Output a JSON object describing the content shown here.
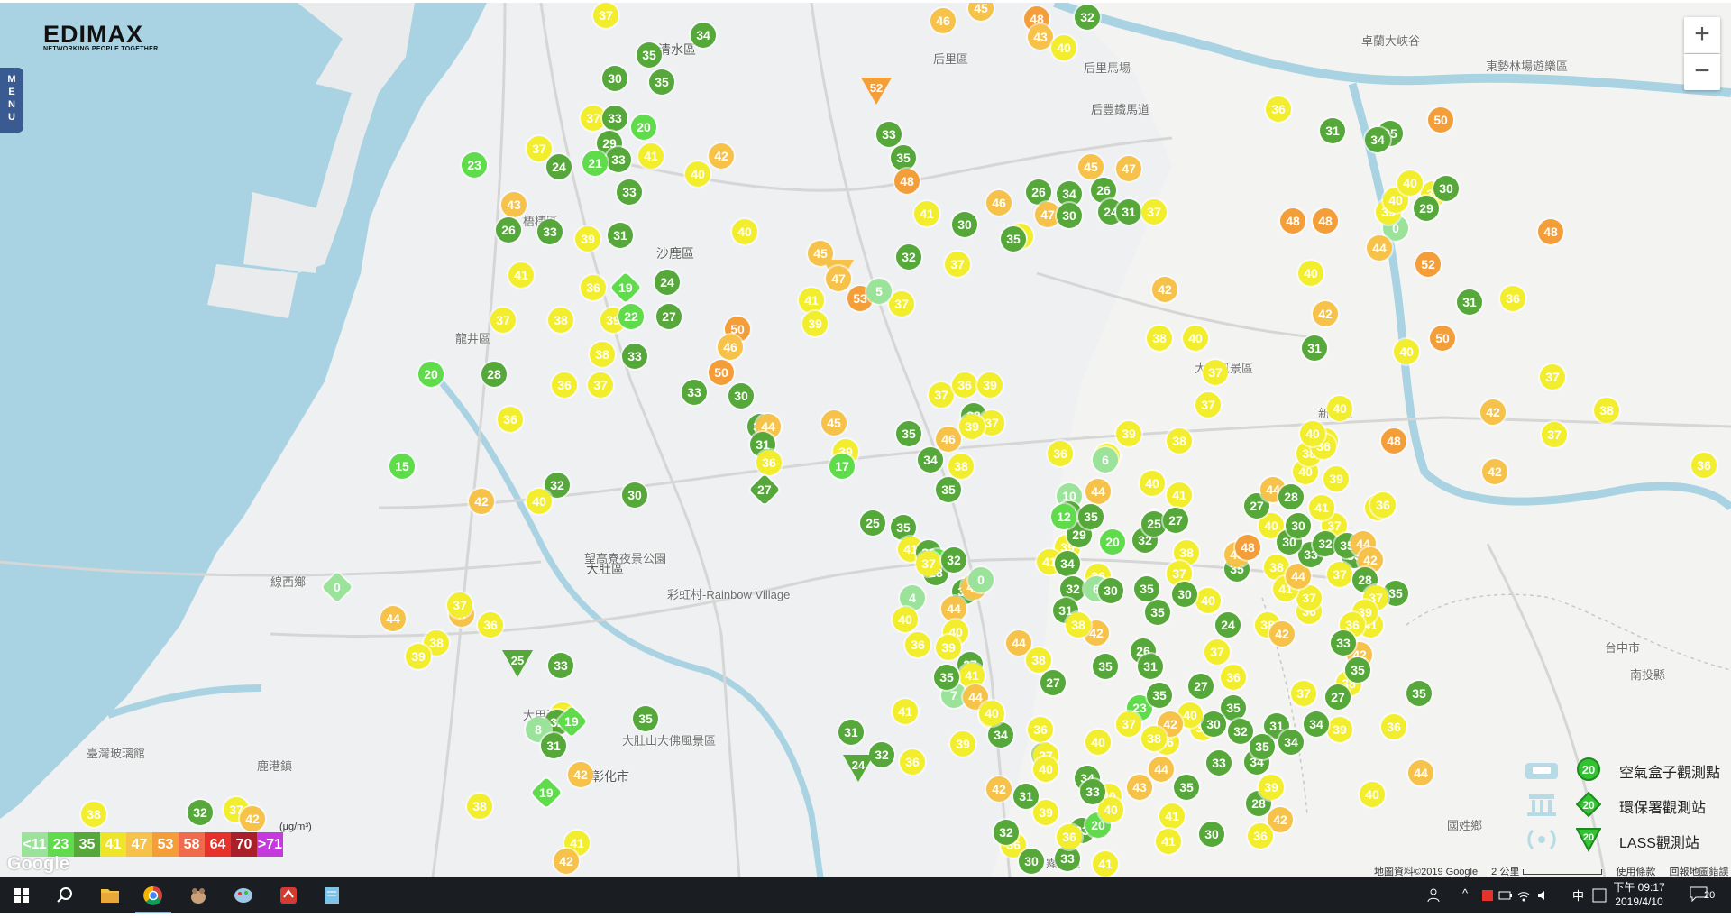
{
  "logo": {
    "word": "EDIMAX",
    "tagline": "NETWORKING PEOPLE TOGETHER"
  },
  "menu_tab": {
    "label": "MENU"
  },
  "zoom": {
    "in_label": "+",
    "out_label": "−"
  },
  "colors": {
    "lt11": "#9be39b",
    "lt23": "#5fdb4c",
    "lt35": "#56a83a",
    "lt41": "#f3ee2d",
    "lt47": "#f6c24a",
    "lt53": "#f49e3a",
    "lt58": "#f06b4b",
    "lt64": "#e5322b",
    "lt70": "#a9202b",
    "gt71": "#c53adc"
  },
  "aqi_scale": {
    "unit": "(μg/m³)",
    "cells": [
      {
        "label": "<11",
        "color": "#9be39b"
      },
      {
        "label": "23",
        "color": "#5fdb4c"
      },
      {
        "label": "35",
        "color": "#56a83a"
      },
      {
        "label": "41",
        "color": "#eee52a"
      },
      {
        "label": "47",
        "color": "#f6c24a"
      },
      {
        "label": "53",
        "color": "#f49e3a"
      },
      {
        "label": "58",
        "color": "#f06b4b"
      },
      {
        "label": "64",
        "color": "#e5322b"
      },
      {
        "label": "70",
        "color": "#a9202b"
      },
      {
        "label": ">71",
        "color": "#c53adc"
      }
    ]
  },
  "places": [
    {
      "text": "清水區",
      "big": true
    },
    {
      "text": "梧棲區"
    },
    {
      "text": "沙鹿區",
      "big": true
    },
    {
      "text": "龍井區"
    },
    {
      "text": "大肚區",
      "big": true
    },
    {
      "text": "線西鄉"
    },
    {
      "text": "鹿港鎮"
    },
    {
      "text": "彰化市",
      "big": true
    },
    {
      "text": "大坑風景區"
    },
    {
      "text": "新社區"
    },
    {
      "text": "后里區"
    },
    {
      "text": "后里馬場"
    },
    {
      "text": "后豐鐵馬道"
    },
    {
      "text": "東勢林場遊樂區"
    },
    {
      "text": "卓蘭大峽谷"
    },
    {
      "text": "國姓鄉"
    },
    {
      "text": "霧峰區"
    },
    {
      "text": "臺灣玻璃館"
    },
    {
      "text": "望高寮夜景公園"
    },
    {
      "text": "大肚山大佛風景區"
    },
    {
      "text": "彩虹村-Rainbow Village"
    },
    {
      "text": "台中市"
    },
    {
      "text": "南投縣"
    },
    {
      "text": "大甲溪"
    }
  ],
  "type_legend": [
    {
      "label": "空氣盒子觀測點",
      "value": "20"
    },
    {
      "label": "環保署觀測站",
      "value": "20"
    },
    {
      "label": "LASS觀測站",
      "value": "20"
    }
  ],
  "attribution": {
    "map_data": "地圖資料©2019 Google",
    "scale": "2 公里",
    "terms": "使用條款",
    "report": "回報地圖錯誤"
  },
  "google_mark": "Google",
  "markers": [
    {
      "v": "37"
    },
    {
      "v": "34"
    },
    {
      "v": "35"
    },
    {
      "v": "35"
    },
    {
      "v": "30"
    },
    {
      "v": "37"
    },
    {
      "v": "33"
    },
    {
      "v": "20"
    },
    {
      "v": "29"
    },
    {
      "v": "33"
    },
    {
      "v": "41"
    },
    {
      "v": "21"
    },
    {
      "v": "24"
    },
    {
      "v": "37"
    },
    {
      "v": "23"
    },
    {
      "v": "40"
    },
    {
      "v": "42"
    },
    {
      "v": "33"
    },
    {
      "v": "43"
    },
    {
      "v": "26"
    },
    {
      "v": "33"
    },
    {
      "v": "39"
    },
    {
      "v": "31"
    },
    {
      "v": "40"
    },
    {
      "v": "41"
    },
    {
      "v": "36"
    },
    {
      "v": "19"
    },
    {
      "v": "24"
    },
    {
      "v": "37"
    },
    {
      "v": "38"
    },
    {
      "v": "39"
    },
    {
      "v": "22"
    },
    {
      "v": "27"
    },
    {
      "v": "38"
    },
    {
      "v": "33"
    },
    {
      "v": "20"
    },
    {
      "v": "28"
    },
    {
      "v": "36"
    },
    {
      "v": "37"
    },
    {
      "v": "36"
    },
    {
      "v": "15"
    },
    {
      "v": "32"
    },
    {
      "v": "40"
    },
    {
      "v": "42"
    },
    {
      "v": "30"
    },
    {
      "v": "0"
    },
    {
      "v": "44"
    },
    {
      "v": "47"
    },
    {
      "v": "37"
    },
    {
      "v": "36"
    },
    {
      "v": "38"
    },
    {
      "v": "39"
    },
    {
      "v": "25"
    },
    {
      "v": "33"
    },
    {
      "v": "41"
    },
    {
      "v": "35"
    },
    {
      "v": "32"
    },
    {
      "v": "19"
    },
    {
      "v": "8"
    },
    {
      "v": "31"
    },
    {
      "v": "42"
    },
    {
      "v": "19"
    },
    {
      "v": "38"
    },
    {
      "v": "37"
    },
    {
      "v": "42"
    },
    {
      "v": "32"
    },
    {
      "v": "38"
    },
    {
      "v": "41"
    },
    {
      "v": "42"
    },
    {
      "v": "46"
    },
    {
      "v": "45"
    },
    {
      "v": "48"
    },
    {
      "v": "43"
    },
    {
      "v": "40"
    },
    {
      "v": "32"
    },
    {
      "v": "52"
    },
    {
      "v": "33"
    },
    {
      "v": "35"
    },
    {
      "v": "48"
    },
    {
      "v": "41"
    },
    {
      "v": "46"
    },
    {
      "v": "30"
    },
    {
      "v": "26"
    },
    {
      "v": "34"
    },
    {
      "v": "47"
    },
    {
      "v": "30"
    },
    {
      "v": "40"
    },
    {
      "v": "35"
    },
    {
      "v": "45"
    },
    {
      "v": "47"
    },
    {
      "v": "26"
    },
    {
      "v": "24"
    },
    {
      "v": "45"
    },
    {
      "v": "43"
    },
    {
      "v": "47"
    },
    {
      "v": "41"
    },
    {
      "v": "53"
    },
    {
      "v": "39"
    },
    {
      "v": "37"
    },
    {
      "v": "5"
    },
    {
      "v": "32"
    },
    {
      "v": "37"
    },
    {
      "v": "50"
    },
    {
      "v": "50"
    },
    {
      "v": "46"
    },
    {
      "v": "33"
    },
    {
      "v": "30"
    },
    {
      "v": "34"
    },
    {
      "v": "44"
    },
    {
      "v": "31"
    },
    {
      "v": "36"
    },
    {
      "v": "27"
    },
    {
      "v": "45"
    },
    {
      "v": "39"
    },
    {
      "v": "17"
    },
    {
      "v": "35"
    },
    {
      "v": "34"
    },
    {
      "v": "46"
    },
    {
      "v": "38"
    },
    {
      "v": "25"
    },
    {
      "v": "35"
    },
    {
      "v": "41"
    },
    {
      "v": "33"
    },
    {
      "v": "11"
    },
    {
      "v": "28"
    },
    {
      "v": "30"
    },
    {
      "v": "44"
    },
    {
      "v": "4"
    },
    {
      "v": "40"
    },
    {
      "v": "39"
    },
    {
      "v": "37"
    },
    {
      "v": "42"
    },
    {
      "v": "40"
    },
    {
      "v": "35"
    },
    {
      "v": "32"
    },
    {
      "v": "0"
    },
    {
      "v": "27"
    },
    {
      "v": "41"
    },
    {
      "v": "40"
    },
    {
      "v": "44"
    },
    {
      "v": "38"
    },
    {
      "v": "36"
    },
    {
      "v": "31"
    },
    {
      "v": "32"
    },
    {
      "v": "24"
    },
    {
      "v": "41"
    },
    {
      "v": "36"
    },
    {
      "v": "39"
    },
    {
      "v": "42"
    },
    {
      "v": "34"
    },
    {
      "v": "7"
    },
    {
      "v": "35"
    },
    {
      "v": "44"
    },
    {
      "v": "40"
    },
    {
      "v": "37"
    },
    {
      "v": "36"
    },
    {
      "v": "39"
    },
    {
      "v": "28"
    },
    {
      "v": "37"
    },
    {
      "v": "39"
    },
    {
      "v": "36"
    },
    {
      "v": "40"
    },
    {
      "v": "10"
    },
    {
      "v": "6"
    },
    {
      "v": "44"
    },
    {
      "v": "27"
    },
    {
      "v": "39"
    },
    {
      "v": "29"
    },
    {
      "v": "12"
    },
    {
      "v": "35"
    },
    {
      "v": "41"
    },
    {
      "v": "34"
    },
    {
      "v": "32"
    },
    {
      "v": "31"
    },
    {
      "v": "20"
    },
    {
      "v": "36"
    },
    {
      "v": "6"
    },
    {
      "v": "30"
    },
    {
      "v": "27"
    },
    {
      "v": "42"
    },
    {
      "v": "35"
    },
    {
      "v": "29"
    },
    {
      "v": "33"
    },
    {
      "v": "33"
    },
    {
      "v": "41"
    },
    {
      "v": "23"
    },
    {
      "v": "37"
    },
    {
      "v": "40"
    },
    {
      "v": "34"
    },
    {
      "v": "20"
    },
    {
      "v": "36"
    },
    {
      "v": "30"
    },
    {
      "v": "31"
    },
    {
      "v": "37"
    },
    {
      "v": "42"
    },
    {
      "v": "38"
    },
    {
      "v": "40"
    },
    {
      "v": "39"
    },
    {
      "v": "40"
    },
    {
      "v": "38"
    },
    {
      "v": "41"
    },
    {
      "v": "38"
    },
    {
      "v": "36"
    },
    {
      "v": "37"
    },
    {
      "v": "39"
    },
    {
      "v": "32"
    },
    {
      "v": "31"
    },
    {
      "v": "40"
    },
    {
      "v": "37"
    },
    {
      "v": "37"
    },
    {
      "v": "35"
    },
    {
      "v": "26"
    },
    {
      "v": "31"
    },
    {
      "v": "35"
    },
    {
      "v": "36"
    },
    {
      "v": "40"
    },
    {
      "v": "48"
    },
    {
      "v": "48"
    },
    {
      "v": "42"
    },
    {
      "v": "31"
    },
    {
      "v": "40"
    },
    {
      "v": "48"
    },
    {
      "v": "36"
    },
    {
      "v": "40"
    },
    {
      "v": "35"
    },
    {
      "v": "0"
    },
    {
      "v": "39"
    },
    {
      "v": "39"
    },
    {
      "v": "29"
    },
    {
      "v": "30"
    },
    {
      "v": "48"
    },
    {
      "v": "36"
    },
    {
      "v": "44"
    },
    {
      "v": "40"
    },
    {
      "v": "31"
    },
    {
      "v": "34"
    },
    {
      "v": "40"
    },
    {
      "v": "50"
    },
    {
      "v": "52"
    },
    {
      "v": "50"
    },
    {
      "v": "31"
    },
    {
      "v": "42"
    },
    {
      "v": "37"
    },
    {
      "v": "38"
    },
    {
      "v": "36"
    },
    {
      "v": "40"
    },
    {
      "v": "37"
    },
    {
      "v": "38"
    },
    {
      "v": "36"
    },
    {
      "v": "42"
    },
    {
      "v": "37"
    },
    {
      "v": "33"
    },
    {
      "v": "37"
    },
    {
      "v": "40"
    },
    {
      "v": "35"
    },
    {
      "v": "41"
    },
    {
      "v": "42"
    },
    {
      "v": "36"
    },
    {
      "v": "44"
    },
    {
      "v": "40"
    },
    {
      "v": "35"
    },
    {
      "v": "38"
    },
    {
      "v": "37"
    },
    {
      "v": "39"
    },
    {
      "v": "35"
    },
    {
      "v": "37"
    },
    {
      "v": "33"
    },
    {
      "v": "34"
    },
    {
      "v": "28"
    },
    {
      "v": "39"
    },
    {
      "v": "42"
    },
    {
      "v": "36"
    },
    {
      "v": "31"
    },
    {
      "v": "30"
    },
    {
      "v": "35"
    },
    {
      "v": "44"
    },
    {
      "v": "43"
    },
    {
      "v": "40"
    },
    {
      "v": "36"
    },
    {
      "v": "33"
    },
    {
      "v": "35"
    },
    {
      "v": "32"
    },
    {
      "v": "25"
    },
    {
      "v": "27"
    },
    {
      "v": "38"
    },
    {
      "v": "37"
    },
    {
      "v": "40"
    },
    {
      "v": "30"
    },
    {
      "v": "24"
    },
    {
      "v": "37"
    },
    {
      "v": "36"
    },
    {
      "v": "27"
    },
    {
      "v": "35"
    },
    {
      "v": "43"
    },
    {
      "v": "48"
    },
    {
      "v": "38"
    },
    {
      "v": "36"
    },
    {
      "v": "37"
    },
    {
      "v": "38"
    },
    {
      "v": "42"
    },
    {
      "v": "41"
    },
    {
      "v": "44"
    },
    {
      "v": "33"
    },
    {
      "v": "30"
    },
    {
      "v": "27"
    },
    {
      "v": "44"
    },
    {
      "v": "28"
    },
    {
      "v": "40"
    },
    {
      "v": "38"
    },
    {
      "v": "36"
    },
    {
      "v": "39"
    },
    {
      "v": "40"
    },
    {
      "v": "37"
    },
    {
      "v": "41"
    },
    {
      "v": "30"
    },
    {
      "v": "32"
    },
    {
      "v": "35"
    },
    {
      "v": "44"
    },
    {
      "v": "42"
    },
    {
      "v": "28"
    },
    {
      "v": "37"
    },
    {
      "v": "39"
    },
    {
      "v": "36"
    },
    {
      "v": "33"
    },
    {
      "v": "35"
    },
    {
      "v": "27"
    },
    {
      "v": "34"
    },
    {
      "v": "34"
    },
    {
      "v": "35"
    },
    {
      "v": "32"
    },
    {
      "v": "30"
    },
    {
      "v": "40"
    },
    {
      "v": "42"
    },
    {
      "v": "38"
    },
    {
      "v": "41"
    },
    {
      "v": "41"
    }
  ],
  "taskbar": {
    "clock_line1": "下午 09:17",
    "clock_line2": "2019/4/10",
    "notify_badge": "20",
    "ime": "中"
  }
}
